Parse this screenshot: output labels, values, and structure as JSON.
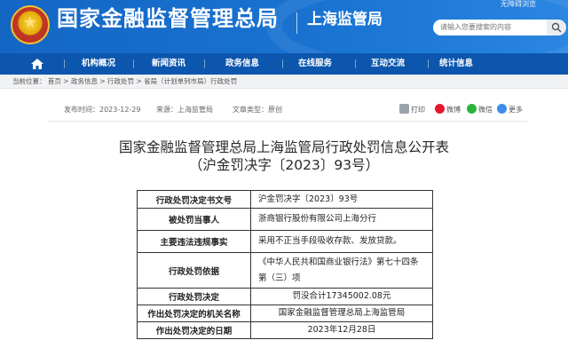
{
  "header": {
    "org_name": "国家金融监督管理总局",
    "branch_name": "上海监管局",
    "accessible_link": "无障碍浏览",
    "search_placeholder": "请输入您要搜索的内容"
  },
  "nav": {
    "items": [
      "机构概况",
      "新闻资讯",
      "政务信息",
      "在线服务",
      "互动交流",
      "统计信息"
    ]
  },
  "breadcrumb": {
    "prefix": "当前位置：",
    "items": [
      "首页",
      "政务信息",
      "行政处罚",
      "省局（计划单列市局）行政处罚"
    ],
    "separator": ">"
  },
  "meta": {
    "publish_date": "发布时间：2023-12-29",
    "source": "来源：上海监管局",
    "doc_type": "文章类型：原创"
  },
  "share": {
    "print": "打印",
    "weibo": "微博",
    "wechat": "微信",
    "more": "更多"
  },
  "document": {
    "title": "国家金融监督管理总局上海监管局行政处罚信息公开表",
    "subtitle": "（沪金罚决字〔2023〕93号）",
    "rows": [
      {
        "key": "行政处罚决定书文号",
        "value": "沪金罚决字〔2023〕93号"
      },
      {
        "key": "被处罚当事人",
        "value": "浙商银行股份有限公司上海分行"
      },
      {
        "key": "主要违法违规事实",
        "value": "采用不正当手段吸收存款、发放贷款。"
      },
      {
        "key": "行政处罚依据",
        "value": "《中华人民共和国商业银行法》第七十四条第（三）项"
      },
      {
        "key": "行政处罚决定",
        "value": "罚没合计17345002.08元"
      },
      {
        "key": "作出处罚决定的机关名称",
        "value": "国家金融监督管理总局上海监管局"
      },
      {
        "key": "作出处罚决定的日期",
        "value": "2023年12月28日"
      }
    ]
  },
  "colors": {
    "header_blue": "#1466c4",
    "nav_blue": "#0c56ad"
  }
}
